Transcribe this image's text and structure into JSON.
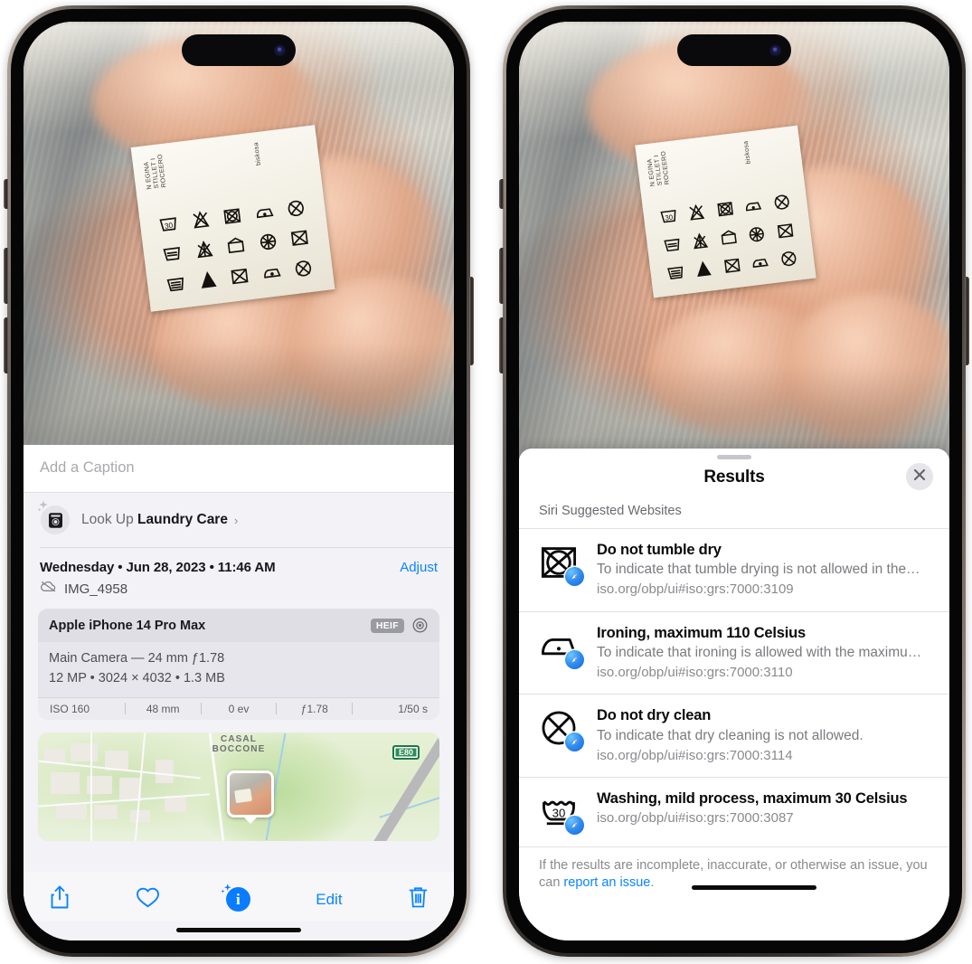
{
  "left_phone": {
    "photo": {
      "alt_name": "laundry-care-label-photo",
      "label_vertical_text_1": "N EGINA\nSTILLET I\nROCEERO",
      "label_vertical_text_2": "biskosa"
    },
    "caption": {
      "placeholder": "Add a Caption",
      "value": ""
    },
    "lookup": {
      "icon": "washing-machine-icon",
      "prefix": "Look Up ",
      "subject": "Laundry Care",
      "chevron": "›"
    },
    "metadata": {
      "date_line": "Wednesday • Jun 28, 2023 • 11:46 AM",
      "adjust_label": "Adjust",
      "cloud_icon": "icloud-slash-icon",
      "file_name": "IMG_4958"
    },
    "exif": {
      "device": "Apple iPhone 14 Pro Max",
      "format_badge": "HEIF",
      "raw_icon": "raw-lens-icon",
      "lens_line": "Main Camera — 24 mm ƒ1.78",
      "size_line": "12 MP • 3024 × 4032 • 1.3 MB",
      "stats": [
        "ISO 160",
        "48 mm",
        "0 ev",
        "ƒ1.78",
        "1/50 s"
      ]
    },
    "map": {
      "town_label_top": "CASAL",
      "town_label_bottom": "BOCCONE",
      "highway_shield": "E80",
      "pin": "photo-location-pin"
    },
    "toolbar": {
      "share_icon": "share-icon",
      "favorite_icon": "heart-icon",
      "info_icon": "info-sparkle-icon",
      "edit_label": "Edit",
      "delete_icon": "trash-icon"
    }
  },
  "right_phone": {
    "sheet": {
      "grabber": "sheet-grabber",
      "title": "Results",
      "close_icon": "close-icon",
      "section_label": "Siri Suggested Websites"
    },
    "results": [
      {
        "icon": "do-not-tumble-dry-icon",
        "badge": "safari-icon",
        "title": "Do not tumble dry",
        "description": "To indicate that tumble drying is not allowed in the…",
        "url": "iso.org/obp/ui#iso:grs:7000:3109"
      },
      {
        "icon": "iron-low-heat-icon",
        "badge": "safari-icon",
        "title": "Ironing, maximum 110 Celsius",
        "description": "To indicate that ironing is allowed with the maximu…",
        "url": "iso.org/obp/ui#iso:grs:7000:3110"
      },
      {
        "icon": "do-not-dry-clean-icon",
        "badge": "safari-icon",
        "title": "Do not dry clean",
        "description": "To indicate that dry cleaning is not allowed.",
        "url": "iso.org/obp/ui#iso:grs:7000:3114"
      },
      {
        "icon": "wash-30-mild-icon",
        "badge": "safari-icon",
        "title": "Washing, mild process, maximum 30 Celsius",
        "description": "",
        "url": "iso.org/obp/ui#iso:grs:7000:3087"
      }
    ],
    "footnote": {
      "text_before": "If the results are incomplete, inaccurate, or otherwise an issue, you can ",
      "link": "report an issue",
      "text_after": "."
    }
  },
  "colors": {
    "accent_blue": "#0a84ff",
    "panel_gray": "#f2f2f7",
    "card_gray": "#e4e4ea",
    "text_primary": "#0a0a0c",
    "text_secondary": "#7b7b80",
    "badge_gray": "#9a9aa2",
    "highway_green": "#2e8b57"
  }
}
